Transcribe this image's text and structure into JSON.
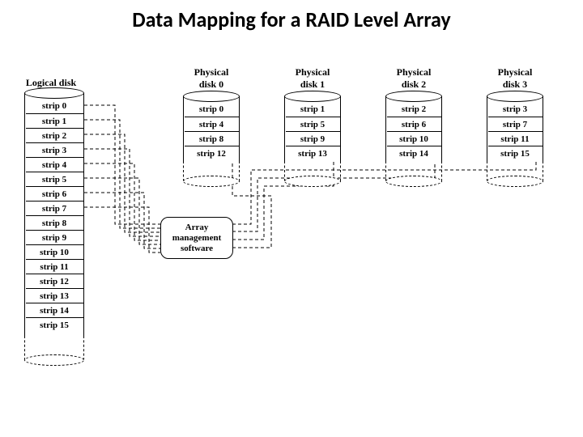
{
  "title": "Data Mapping for a RAID Level Array",
  "logical": {
    "label": "Logical disk",
    "strips": [
      "strip 0",
      "strip 1",
      "strip 2",
      "strip 3",
      "strip 4",
      "strip 5",
      "strip 6",
      "strip 7",
      "strip 8",
      "strip 9",
      "strip 10",
      "strip 11",
      "strip 12",
      "strip 13",
      "strip 14",
      "strip 15"
    ]
  },
  "ams": {
    "line1": "Array",
    "line2": "management",
    "line3": "software"
  },
  "disks": [
    {
      "label": "Physical\ndisk 0",
      "strips": [
        "strip 0",
        "strip 4",
        "strip 8",
        "strip 12"
      ]
    },
    {
      "label": "Physical\ndisk 1",
      "strips": [
        "strip 1",
        "strip 5",
        "strip 9",
        "strip 13"
      ]
    },
    {
      "label": "Physical\ndisk 2",
      "strips": [
        "strip 2",
        "strip 6",
        "strip 10",
        "strip 14"
      ]
    },
    {
      "label": "Physical\ndisk 3",
      "strips": [
        "strip 3",
        "strip 7",
        "strip 11",
        "strip 15"
      ]
    }
  ]
}
